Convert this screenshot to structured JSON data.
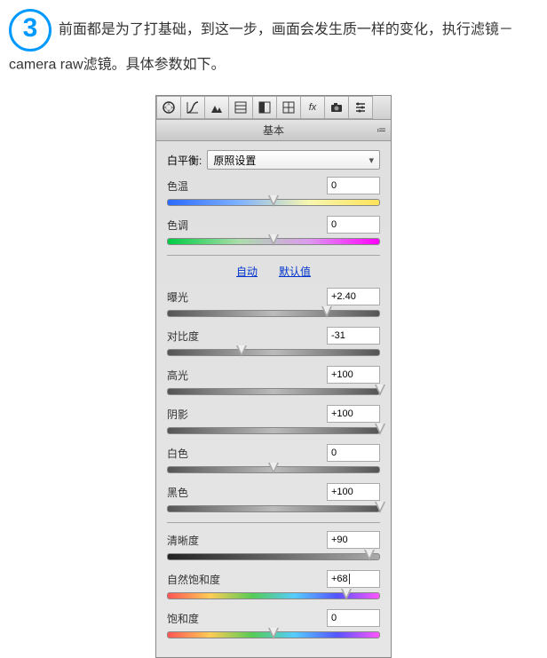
{
  "intro": {
    "step_number": "3",
    "text": "前面都是为了打基础，到这一步，画面会发生质一样的变化，执行滤镜－camera raw滤镜。具体参数如下。"
  },
  "panel": {
    "title": "基本",
    "links": {
      "auto": "自动",
      "default": "默认值"
    },
    "white_balance": {
      "label": "白平衡:",
      "selected": "原照设置"
    },
    "sliders": {
      "temperature": {
        "label": "色温",
        "value": "0",
        "pos": 50
      },
      "tint": {
        "label": "色调",
        "value": "0",
        "pos": 50
      },
      "exposure": {
        "label": "曝光",
        "value": "+2.40",
        "pos": 75
      },
      "contrast": {
        "label": "对比度",
        "value": "-31",
        "pos": 35
      },
      "highlights": {
        "label": "高光",
        "value": "+100",
        "pos": 100
      },
      "shadows": {
        "label": "阴影",
        "value": "+100",
        "pos": 100
      },
      "whites": {
        "label": "白色",
        "value": "0",
        "pos": 50
      },
      "blacks": {
        "label": "黑色",
        "value": "+100",
        "pos": 100
      },
      "clarity": {
        "label": "清晰度",
        "value": "+90",
        "pos": 95
      },
      "vibrance": {
        "label": "自然饱和度",
        "value": "+68",
        "pos": 84
      },
      "saturation": {
        "label": "饱和度",
        "value": "0",
        "pos": 50
      }
    }
  }
}
